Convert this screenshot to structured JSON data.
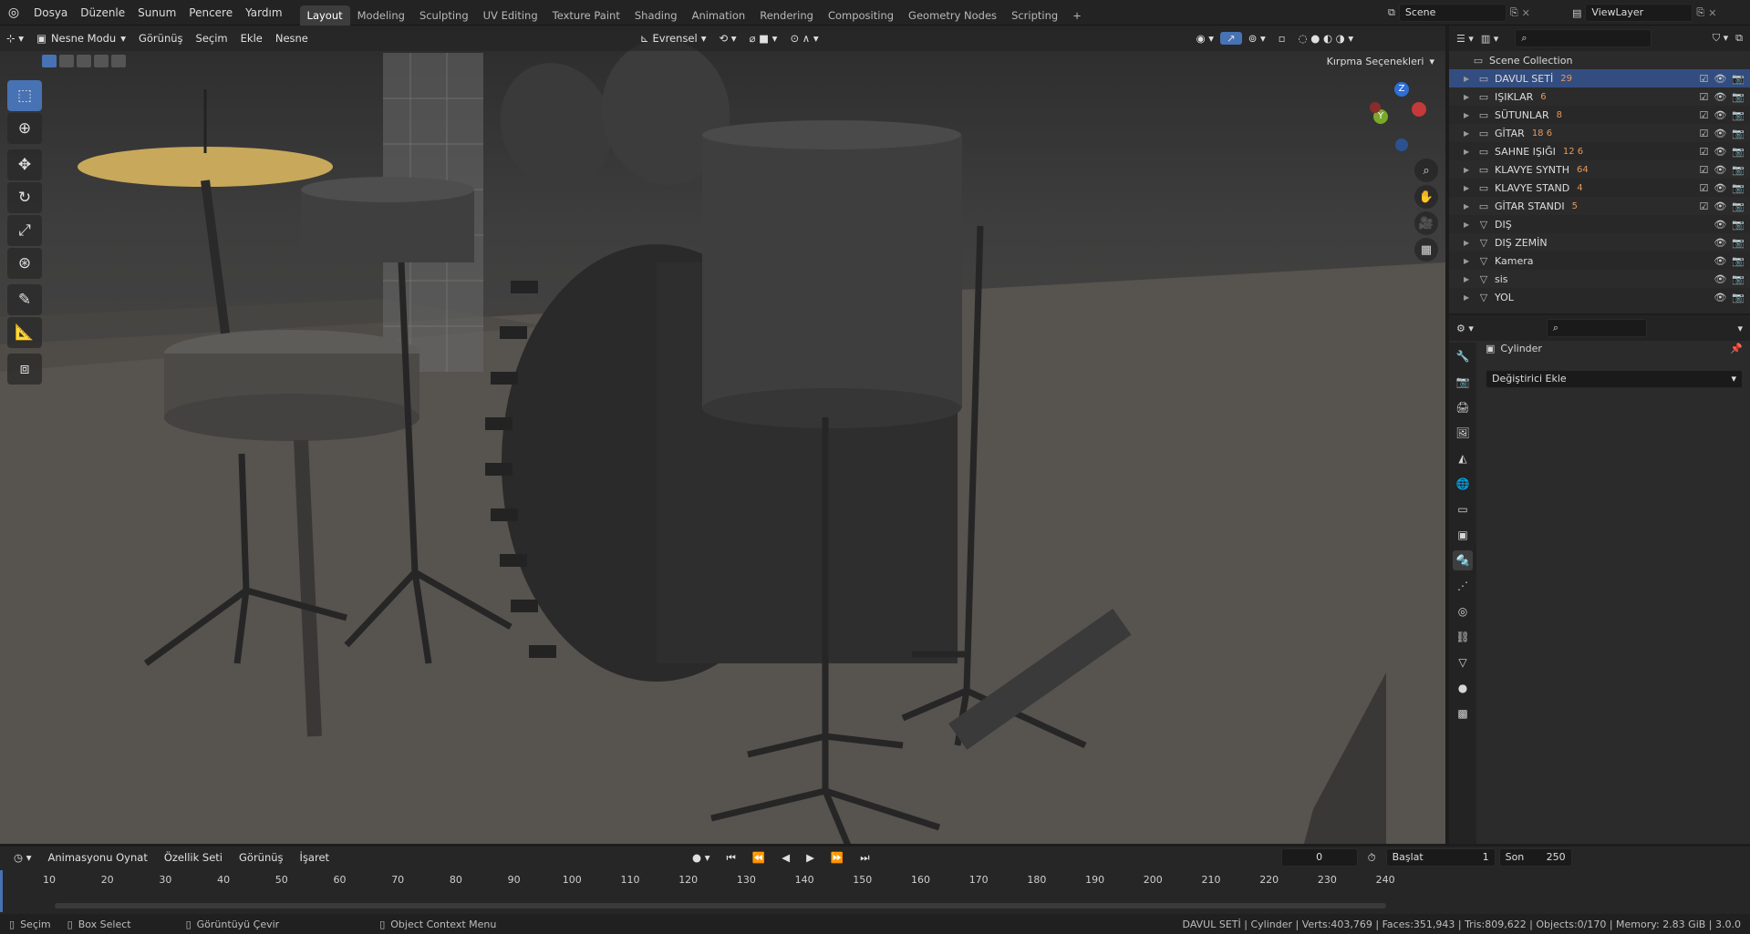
{
  "topbar": {
    "menus": [
      "Dosya",
      "Düzenle",
      "Sunum",
      "Pencere",
      "Yardım"
    ],
    "workspaces": [
      "Layout",
      "Modeling",
      "Sculpting",
      "UV Editing",
      "Texture Paint",
      "Shading",
      "Animation",
      "Rendering",
      "Compositing",
      "Geometry Nodes",
      "Scripting"
    ],
    "active_workspace": "Layout",
    "add_tab": "+",
    "scene_name": "Scene",
    "view_layer": "ViewLayer"
  },
  "viewport": {
    "mode": "Nesne Modu",
    "menus": [
      "Görünüş",
      "Seçim",
      "Ekle",
      "Nesne"
    ],
    "transform_orientation": "Evrensel",
    "clipping_options": "Kırpma Seçenekleri",
    "gizmo_axes": {
      "z": "Z",
      "y": "Y"
    }
  },
  "outliner": {
    "root": "Scene Collection",
    "items": [
      {
        "name": "DAVUL SETİ",
        "badge": "29",
        "checked": true
      },
      {
        "name": "IŞIKLAR",
        "badge": "6",
        "checked": true
      },
      {
        "name": "SÜTUNLAR",
        "badge": "8",
        "checked": true
      },
      {
        "name": "GİTAR",
        "badge": "18 6",
        "checked": true
      },
      {
        "name": "SAHNE IŞIĞI",
        "badge": "12 6",
        "checked": true
      },
      {
        "name": "KLAVYE SYNTH",
        "badge": "64",
        "checked": true
      },
      {
        "name": "KLAVYE STAND",
        "badge": "4",
        "checked": true
      },
      {
        "name": "GİTAR STANDI",
        "badge": "5",
        "checked": true
      },
      {
        "name": "DIŞ",
        "badge": "",
        "checked": false
      },
      {
        "name": "DIŞ ZEMİN",
        "badge": "",
        "checked": false
      },
      {
        "name": "Kamera",
        "badge": "",
        "checked": false
      },
      {
        "name": "sis",
        "badge": "",
        "checked": false
      },
      {
        "name": "YOL",
        "badge": "",
        "checked": false
      }
    ]
  },
  "properties": {
    "object_name": "Cylinder",
    "add_modifier": "Değiştirici Ekle"
  },
  "timeline": {
    "menus": [
      "Animasyonu Oynat",
      "Özellik Seti",
      "Görünüş",
      "İşaret"
    ],
    "current_frame": "0",
    "start_label": "Başlat",
    "start_value": "1",
    "end_label": "Son",
    "end_value": "250",
    "ticks": [
      "10",
      "20",
      "30",
      "40",
      "50",
      "60",
      "70",
      "80",
      "90",
      "100",
      "110",
      "120",
      "130",
      "140",
      "150",
      "160",
      "170",
      "180",
      "190",
      "200",
      "210",
      "220",
      "230",
      "240"
    ]
  },
  "statusbar": {
    "select": "Seçim",
    "box_select": "Box Select",
    "rotate_view": "Görüntüyü Çevir",
    "context_menu": "Object Context Menu",
    "stats": "DAVUL SETİ | Cylinder | Verts:403,769 | Faces:351,943 | Tris:809,622 | Objects:0/170 | Memory: 2.83 GiB | 3.0.0"
  },
  "colors": {
    "accent": "#4772b3",
    "selected_row": "#334d80",
    "cymbal": "#c8a85a"
  }
}
